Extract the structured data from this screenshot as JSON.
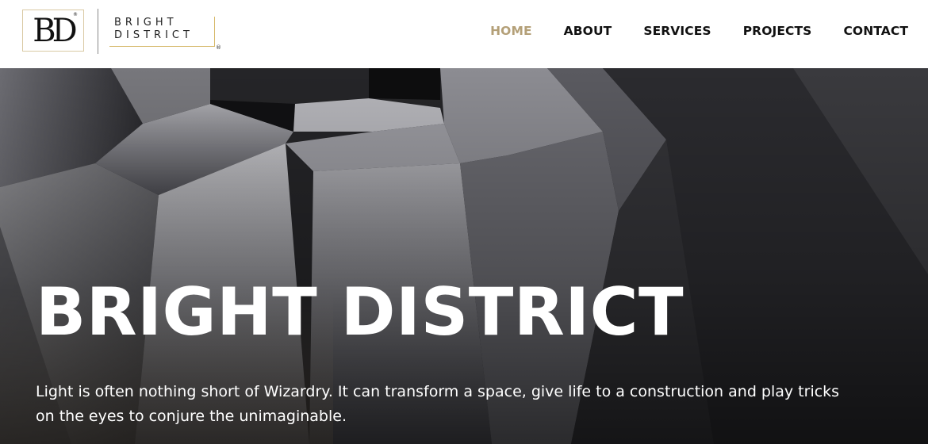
{
  "header": {
    "logo": {
      "mark": "BD",
      "word_line1": "BRIGHT",
      "word_line2": "DISTRICT",
      "registered": "®"
    },
    "nav": [
      {
        "label": "HOME",
        "active": true
      },
      {
        "label": "ABOUT",
        "active": false
      },
      {
        "label": "SERVICES",
        "active": false
      },
      {
        "label": "PROJECTS",
        "active": false
      },
      {
        "label": "CONTACT",
        "active": false
      }
    ],
    "active_color": "#b4a078"
  },
  "hero": {
    "title": "BRIGHT DISTRICT",
    "text": "Light is often nothing short of Wizardry. It can transform a space, give life to a construction and play tricks on the eyes to conjure the unimaginable."
  }
}
